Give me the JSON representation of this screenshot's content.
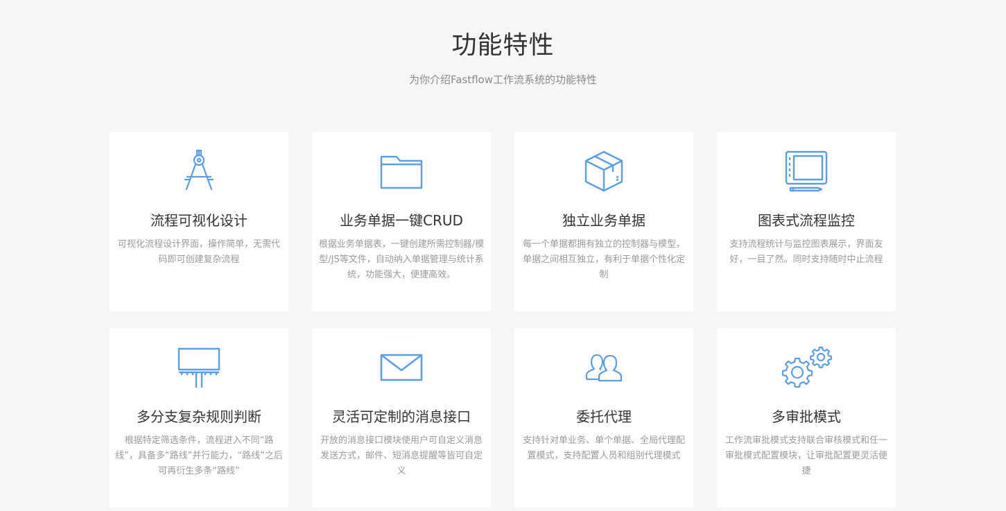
{
  "header": {
    "title": "功能特性",
    "subtitle": "为你介绍Fastflow工作流系统的功能特性"
  },
  "colors": {
    "background": "#f6f6f6",
    "card": "#ffffff",
    "icon": "#5a9de6",
    "title": "#333333",
    "desc": "#999999"
  },
  "features": [
    {
      "icon": "compass-icon",
      "title": "流程可视化设计",
      "desc": "可视化流程设计界面，操作简单，无需代码即可创建复杂流程"
    },
    {
      "icon": "folder-icon",
      "title": "业务单据一键CRUD",
      "desc": "根据业务单据表，一键创建所需控制器/模型/JS等文件，自动纳入单据管理与统计系统，功能强大，便捷高效。"
    },
    {
      "icon": "box-icon",
      "title": "独立业务单据",
      "desc": "每一个单据都拥有独立的控制器与模型，单据之间相互独立，有利于单据个性化定制"
    },
    {
      "icon": "tablet-icon",
      "title": "图表式流程监控",
      "desc": "支持流程统计与监控图表展示，界面友好，一目了然。同时支持随时中止流程"
    },
    {
      "icon": "billboard-icon",
      "title": "多分支复杂规则判断",
      "desc": "根据特定筛选条件，流程进入不同“路线”，具备多“路线”并行能力，“路线”之后可再衍生多条“路线”"
    },
    {
      "icon": "envelope-icon",
      "title": "灵活可定制的消息接口",
      "desc": "开放的消息接口模块使用户可自定义消息发送方式，邮件、短消息提醒等皆可自定义"
    },
    {
      "icon": "users-icon",
      "title": "委托代理",
      "desc": "支持针对单业务、单个单据、全局代理配置模式，支持配置人员和组别代理模式"
    },
    {
      "icon": "gears-icon",
      "title": "多审批模式",
      "desc": "工作流审批模式支持联合审核模式和任一审批模式配置模块，让审批配置更灵活便捷"
    }
  ]
}
